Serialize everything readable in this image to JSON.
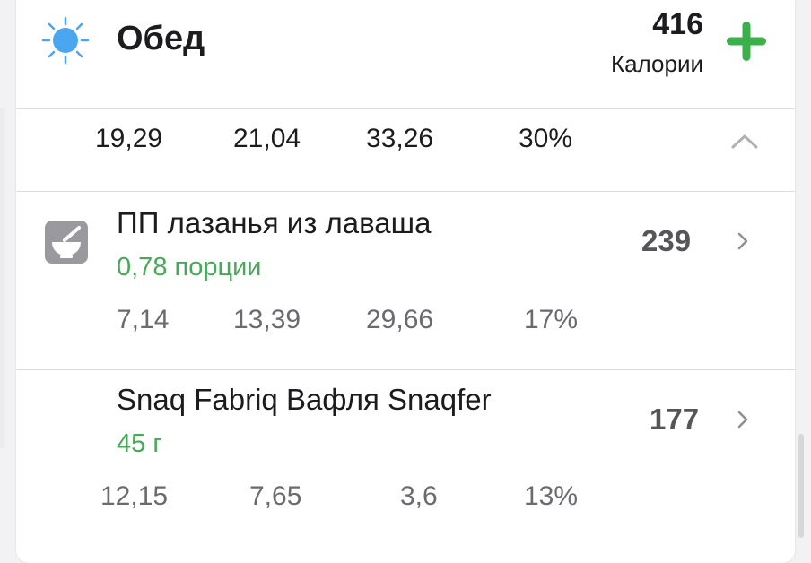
{
  "meal": {
    "title": "Обед",
    "total_calories": "416",
    "calories_label": "Калории",
    "icon": "sun-icon",
    "add_icon": "plus-icon"
  },
  "summary": {
    "protein": "19,29",
    "fat": "21,04",
    "carbs": "33,26",
    "percent": "30%",
    "collapse_icon": "chevron-up-icon"
  },
  "items": [
    {
      "name": "ПП лазанья из лаваша",
      "portion": "0,78 порции",
      "calories": "239",
      "protein": "7,14",
      "fat": "13,39",
      "carbs": "29,66",
      "percent": "17%",
      "icon": "recipe-mortar-icon"
    },
    {
      "name": "Snaq Fabriq Вафля Snaqfer",
      "portion": "45 г",
      "calories": "177",
      "protein": "12,15",
      "fat": "7,65",
      "carbs": "3,6",
      "percent": "13%",
      "icon": ""
    }
  ],
  "colors": {
    "accent_green": "#3bb04a",
    "portion_green": "#49a85a",
    "sun_blue": "#4aa6f0",
    "icon_gray": "#9a9a9e"
  }
}
